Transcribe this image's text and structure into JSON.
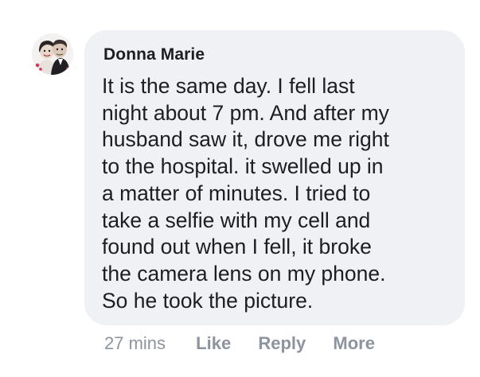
{
  "comment": {
    "author": "Donna Marie",
    "text": "It is the same day. I fell last\nnight about 7 pm. And after my\nhusband saw it, drove me right\nto the hospital. it swelled up in\na matter of minutes. I tried to\ntake a selfie with my cell and\nfound out when I fell, it broke\nthe camera lens on my phone.\nSo he took the picture.",
    "timestamp": "27 mins",
    "actions": {
      "like": "Like",
      "reply": "Reply",
      "more": "More"
    }
  },
  "colors": {
    "bubble": "#f0f1f4",
    "text": "#1c1e21",
    "meta": "#8d949e"
  },
  "icons": {
    "avatar": "profile-photo-icon"
  }
}
